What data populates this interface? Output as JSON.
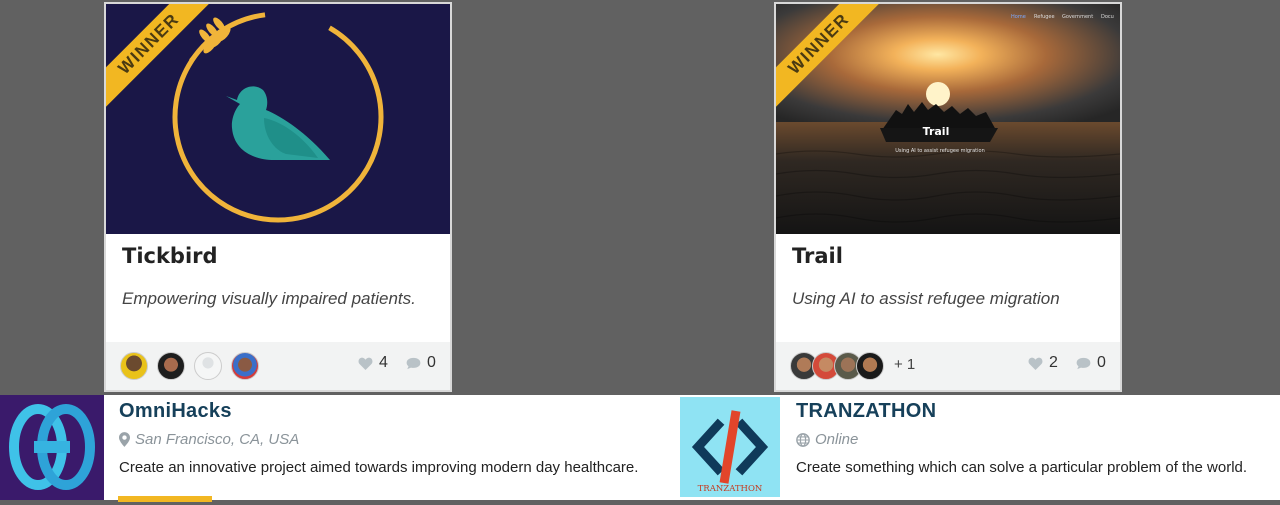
{
  "cards": [
    {
      "badge": "WINNER",
      "title": "Tickbird",
      "description": "Empowering visually impaired patients.",
      "likes": "4",
      "comments": "0",
      "extra_members": ""
    },
    {
      "badge": "WINNER",
      "title": "Trail",
      "description": "Using AI to assist refugee migration",
      "likes": "2",
      "comments": "0",
      "extra_members": "+ 1",
      "image": {
        "title": "Trail",
        "subtitle": "Using AI to assist refugee migration",
        "nav": [
          "Home",
          "Refugee",
          "Government",
          "Docu"
        ]
      }
    }
  ],
  "hackathons": [
    {
      "name": "OmniHacks",
      "location": "San Francisco, CA, USA",
      "location_icon": "map-pin-icon",
      "description": "Create an innovative project aimed towards improving modern day healthcare."
    },
    {
      "name": "TRANZATHON",
      "location": "Online",
      "location_icon": "globe-icon",
      "description": "Create something which can solve a particular problem of the world.",
      "logo_text": "TRANZATHON"
    }
  ],
  "colors": {
    "accent": "#f2b722",
    "hackathon_name": "#16405a",
    "backdrop": "#616161"
  }
}
